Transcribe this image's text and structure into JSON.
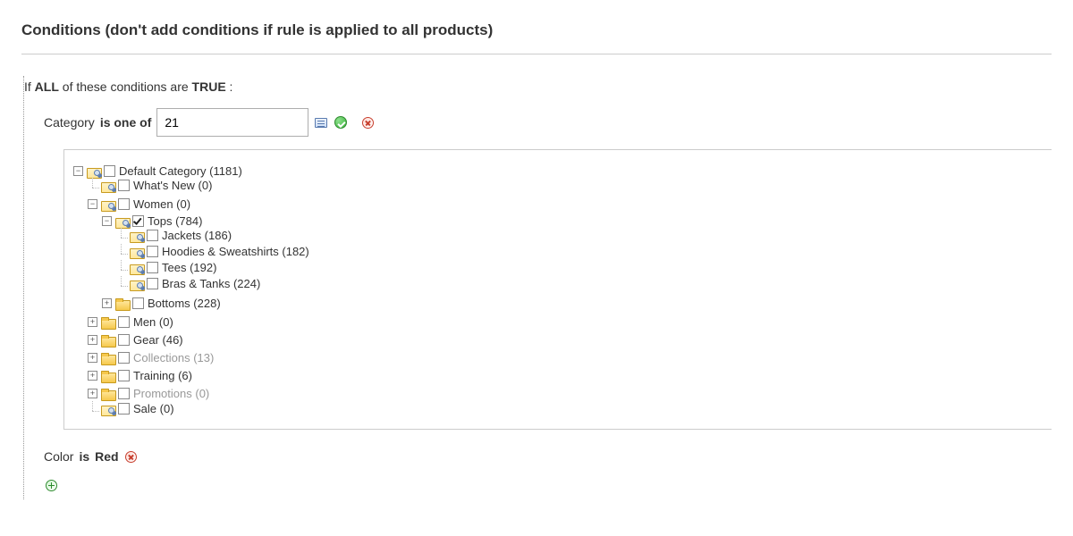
{
  "section_title": "Conditions (don't add conditions if rule is applied to all products)",
  "sentence": {
    "prefix": "If ",
    "aggregator": "ALL",
    "mid": " of these conditions are ",
    "value": "TRUE",
    "suffix": " :"
  },
  "condition1": {
    "attribute": "Category",
    "operator": "is one of",
    "value": "21"
  },
  "condition2": {
    "attribute": "Color",
    "operator": "is",
    "value": "Red"
  },
  "tree": [
    {
      "label": "Default Category (1181)",
      "depth": 0,
      "toggle": "minus",
      "folder": "mag",
      "checked": false,
      "muted": false
    },
    {
      "label": "What's New (0)",
      "depth": 1,
      "toggle": "elbow",
      "folder": "mag",
      "checked": false,
      "muted": false
    },
    {
      "label": "Women (0)",
      "depth": 1,
      "toggle": "minus",
      "folder": "mag",
      "checked": false,
      "muted": false
    },
    {
      "label": "Tops (784)",
      "depth": 2,
      "toggle": "minus",
      "folder": "mag",
      "checked": true,
      "muted": false
    },
    {
      "label": "Jackets (186)",
      "depth": 3,
      "toggle": "elbow",
      "folder": "mag",
      "checked": false,
      "muted": false
    },
    {
      "label": "Hoodies & Sweatshirts (182)",
      "depth": 3,
      "toggle": "elbow",
      "folder": "mag",
      "checked": false,
      "muted": false
    },
    {
      "label": "Tees (192)",
      "depth": 3,
      "toggle": "elbow",
      "folder": "mag",
      "checked": false,
      "muted": false
    },
    {
      "label": "Bras & Tanks (224)",
      "depth": 3,
      "toggle": "elbow-end",
      "folder": "mag",
      "checked": false,
      "muted": false
    },
    {
      "label": "Bottoms (228)",
      "depth": 2,
      "toggle": "plus",
      "folder": "closed",
      "checked": false,
      "muted": false
    },
    {
      "label": "Men (0)",
      "depth": 1,
      "toggle": "plus",
      "folder": "closed",
      "checked": false,
      "muted": false
    },
    {
      "label": "Gear (46)",
      "depth": 1,
      "toggle": "plus",
      "folder": "closed",
      "checked": false,
      "muted": false
    },
    {
      "label": "Collections (13)",
      "depth": 1,
      "toggle": "plus",
      "folder": "closed",
      "checked": false,
      "muted": true
    },
    {
      "label": "Training (6)",
      "depth": 1,
      "toggle": "plus",
      "folder": "closed",
      "checked": false,
      "muted": false
    },
    {
      "label": "Promotions (0)",
      "depth": 1,
      "toggle": "plus",
      "folder": "closed",
      "checked": false,
      "muted": true
    },
    {
      "label": "Sale (0)",
      "depth": 1,
      "toggle": "elbow-end",
      "folder": "mag",
      "checked": false,
      "muted": false
    }
  ]
}
